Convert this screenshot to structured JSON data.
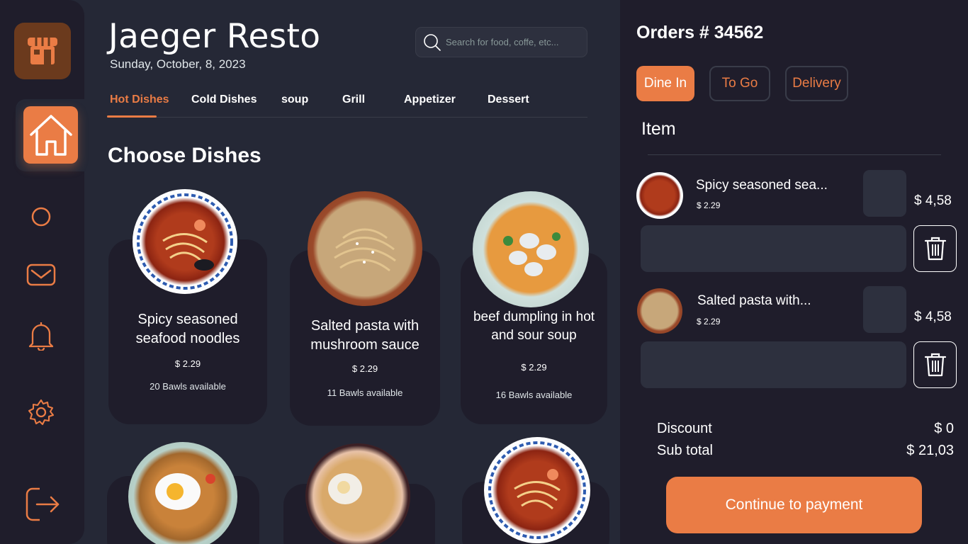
{
  "app": {
    "title": "Jaeger Resto",
    "date": "Sunday, October, 8, 2023"
  },
  "colors": {
    "accent": "#ea7c45",
    "background": "#252836",
    "panel": "#1f1d2b",
    "field": "#2d303e"
  },
  "search": {
    "placeholder": "Search for food, coffe, etc..."
  },
  "sidebar": {
    "icons": [
      "store-icon",
      "home-icon",
      "circle-icon",
      "mail-icon",
      "bell-icon",
      "gear-icon",
      "logout-icon"
    ],
    "active": "home"
  },
  "tabs": [
    "Hot Dishes",
    "Cold Dishes",
    "soup",
    "Grill",
    "Appetizer",
    "Dessert"
  ],
  "active_tab": "Hot Dishes",
  "section_title": "Choose Dishes",
  "dishes": [
    {
      "name": "Spicy seasoned seafood noodles",
      "price": "$ 2.29",
      "availability": "20 Bawls available"
    },
    {
      "name": "Salted pasta with mushroom sauce",
      "price": "$ 2.29",
      "availability": "11 Bawls available"
    },
    {
      "name": "beef dumpling in hot and sour soup",
      "price": "$ 2.29",
      "availability": "16 Bawls available"
    }
  ],
  "orders": {
    "title": "Orders # 34562",
    "types": [
      "Dine In",
      "To Go",
      "Delivery"
    ],
    "active_type": "Dine In",
    "item_header": "Item",
    "items": [
      {
        "name": "Spicy seasoned sea...",
        "price": "$ 2.29",
        "total": "$ 4,58"
      },
      {
        "name": "Salted pasta with...",
        "price": "$ 2.29",
        "total": "$ 4,58"
      }
    ],
    "discount_label": "Discount",
    "discount_value": "$ 0",
    "subtotal_label": "Sub total",
    "subtotal_value": "$ 21,03",
    "pay_button": "Continue to payment"
  }
}
